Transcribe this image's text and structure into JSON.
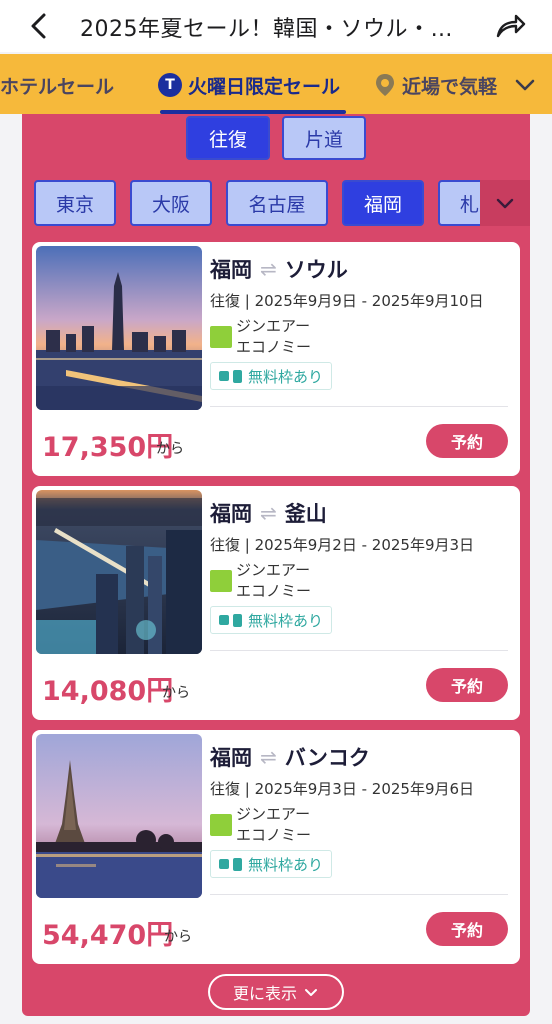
{
  "header": {
    "title": "2025年夏セール！韓国・ソウル・…"
  },
  "categories": [
    {
      "label": "ホテルセール"
    },
    {
      "label": "火曜日限定セール",
      "icon_text": "T"
    },
    {
      "label": "近場で気軽"
    }
  ],
  "trip_types": [
    {
      "label": "往復"
    },
    {
      "label": "片道"
    }
  ],
  "cities": [
    {
      "label": "東京"
    },
    {
      "label": "大阪"
    },
    {
      "label": "名古屋"
    },
    {
      "label": "福岡"
    },
    {
      "label": "札"
    }
  ],
  "deals": [
    {
      "origin": "福岡",
      "destination": "ソウル",
      "dates": "往復 | 2025年9月9日 - 2025年9月10日",
      "airline": "ジンエアー",
      "cabin": "エコノミー",
      "baggage": "無料枠あり",
      "price": "17,350円",
      "from": "から",
      "book": "予約"
    },
    {
      "origin": "福岡",
      "destination": "釜山",
      "dates": "往復 | 2025年9月2日 - 2025年9月3日",
      "airline": "ジンエアー",
      "cabin": "エコノミー",
      "baggage": "無料枠あり",
      "price": "14,080円",
      "from": "から",
      "book": "予約"
    },
    {
      "origin": "福岡",
      "destination": "バンコク",
      "dates": "往復 | 2025年9月3日 - 2025年9月6日",
      "airline": "ジンエアー",
      "cabin": "エコノミー",
      "baggage": "無料枠あり",
      "price": "54,470円",
      "from": "から",
      "book": "予約"
    }
  ],
  "show_more": "更に表示",
  "colors": {
    "accent": "#d8476a",
    "category_bar": "#f6b93b",
    "active_blue": "#2f3fe0"
  }
}
